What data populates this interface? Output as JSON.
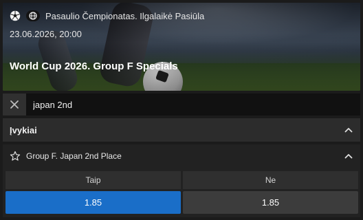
{
  "event": {
    "league": "Pasaulio Čempionatas. Ilgalaikė Pasiūla",
    "date": "23.06.2026, 20:00",
    "title": "World Cup 2026. Group F Specials",
    "sport_icon": "soccer-ball-icon",
    "globe_icon": "globe-icon"
  },
  "search": {
    "value": "japan 2nd",
    "clear_icon": "close-icon"
  },
  "events_section": {
    "label": "Įvykiai",
    "expanded": true
  },
  "market": {
    "name": "Group F. Japan 2nd Place",
    "favorite_icon": "star-icon",
    "outcomes": [
      {
        "label": "Taip",
        "odds": "1.85",
        "selected": true
      },
      {
        "label": "Ne",
        "odds": "1.85",
        "selected": false
      }
    ]
  },
  "colors": {
    "selected": "#1a6ec8",
    "background": "#1b1b1b"
  }
}
